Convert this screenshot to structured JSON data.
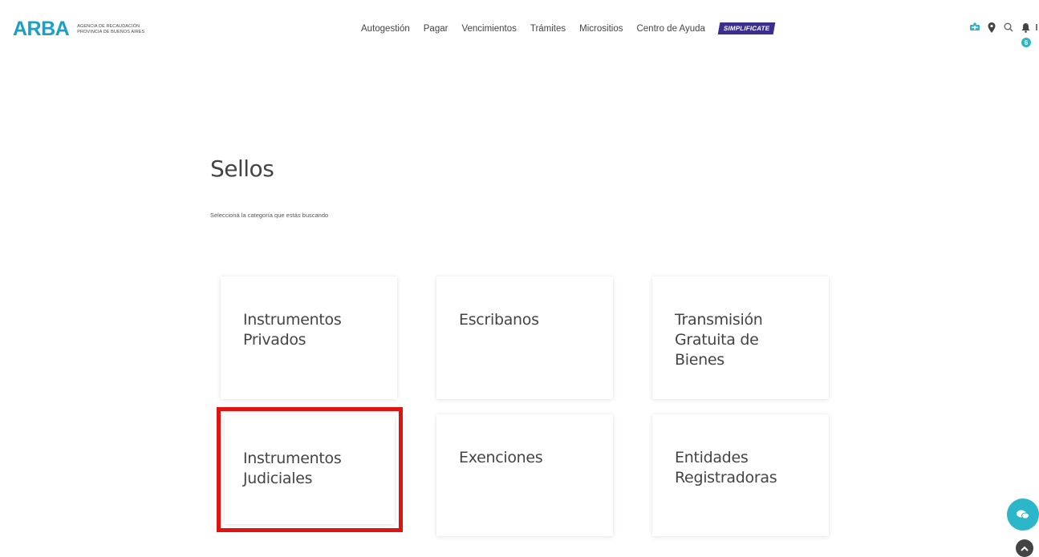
{
  "brand": {
    "name": "ARBA",
    "subtitle_line1": "Agencia de Recaudación",
    "subtitle_line2": "Provincia de Buenos Aires",
    "color": "#1aa0c7"
  },
  "nav": {
    "items": [
      {
        "label": "Autogestión"
      },
      {
        "label": "Pagar"
      },
      {
        "label": "Vencimientos"
      },
      {
        "label": "Trámites"
      },
      {
        "label": "Micrositios"
      },
      {
        "label": "Centro de Ayuda"
      }
    ],
    "badge_label": "SIMPLIFICATE",
    "badge_color": "#3a2f8c"
  },
  "header_icons": [
    "accessibility-icon",
    "location-pin-icon",
    "search-icon",
    "bell-icon"
  ],
  "notifications": {
    "count": "6"
  },
  "page": {
    "title": "Sellos",
    "subtitle": "Seleccioná la categoría que estás buscando"
  },
  "cards": [
    {
      "label": "Instrumentos Privados"
    },
    {
      "label": "Escribanos"
    },
    {
      "label": "Transmisión Gratuita de Bienes"
    },
    {
      "label": "Instrumentos Judiciales",
      "highlighted": true
    },
    {
      "label": "Exenciones"
    },
    {
      "label": "Entidades Registradoras"
    }
  ],
  "colors": {
    "accent": "#2bb7c9",
    "highlight": "#e01212"
  },
  "floating": {
    "chat_icon": "chat-bubbles-icon",
    "top_icon": "chevron-up-icon"
  }
}
